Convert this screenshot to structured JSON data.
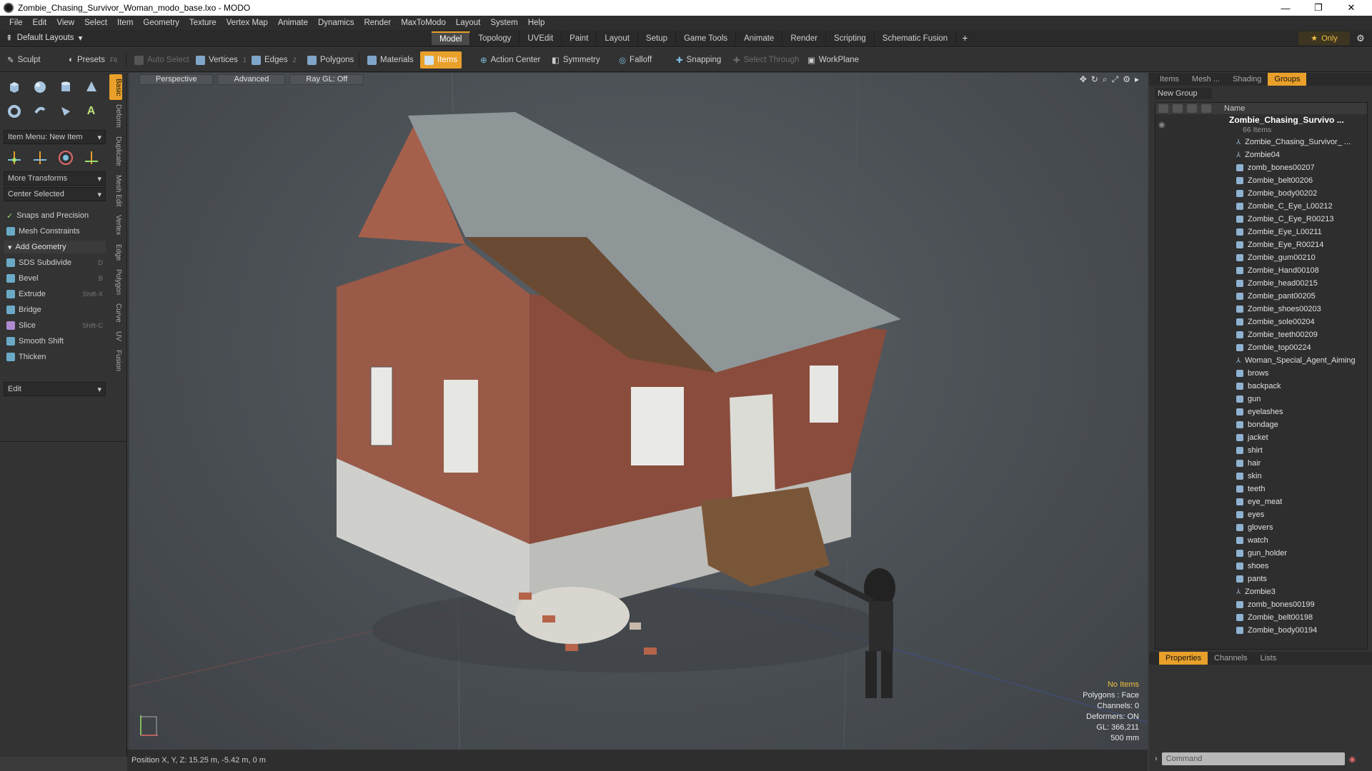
{
  "window": {
    "title": "Zombie_Chasing_Survivor_Woman_modo_base.lxo - MODO",
    "minimize": "—",
    "maximize": "❐",
    "close": "✕"
  },
  "menu": [
    "File",
    "Edit",
    "View",
    "Select",
    "Item",
    "Geometry",
    "Texture",
    "Vertex Map",
    "Animate",
    "Dynamics",
    "Render",
    "MaxToModo",
    "Layout",
    "System",
    "Help"
  ],
  "layout": {
    "default_layouts": "Default Layouts",
    "tabs": [
      "Model",
      "Topology",
      "UVEdit",
      "Paint",
      "Layout",
      "Setup",
      "Game Tools",
      "Animate",
      "Render",
      "Scripting",
      "Schematic Fusion"
    ],
    "active_tab": "Model",
    "plus": "+",
    "only_label": "Only"
  },
  "toolbar": {
    "sculpt": "Sculpt",
    "presets": "Presets",
    "presets_key": "F6",
    "auto_select": "Auto Select",
    "vertices": "Vertices",
    "vertices_key": "1",
    "edges": "Edges",
    "edges_key": "2",
    "polygons": "Polygons",
    "materials": "Materials",
    "items": "Items",
    "action_center": "Action Center",
    "symmetry": "Symmetry",
    "falloff": "Falloff",
    "snapping": "Snapping",
    "select_through": "Select Through",
    "workplane": "WorkPlane"
  },
  "left_panel": {
    "vertical_tabs": [
      "Basic",
      "Deform",
      "Duplicate",
      "Mesh Edit",
      "Vertex",
      "Edge",
      "Polygon",
      "Curve",
      "UV",
      "Fusion"
    ],
    "item_menu": "Item Menu: New Item",
    "more_transforms": "More Transforms",
    "center_selected": "Center Selected",
    "snaps_precision": "Snaps and Precision",
    "mesh_constraints": "Mesh Constraints",
    "add_geometry": "Add Geometry",
    "tools": [
      {
        "label": "SDS Subdivide",
        "shortcut": "D"
      },
      {
        "label": "Bevel",
        "shortcut": "B"
      },
      {
        "label": "Extrude",
        "shortcut": "Shift-X"
      },
      {
        "label": "Bridge",
        "shortcut": ""
      },
      {
        "label": "Slice",
        "shortcut": "Shift-C"
      },
      {
        "label": "Smooth Shift",
        "shortcut": ""
      },
      {
        "label": "Thicken",
        "shortcut": ""
      }
    ],
    "edit": "Edit"
  },
  "viewport": {
    "perspective": "Perspective",
    "advanced": "Advanced",
    "raygl": "Ray GL: Off",
    "stats": {
      "no_items": "No Items",
      "polygons": "Polygons : Face",
      "channels": "Channels: 0",
      "deformers": "Deformers: ON",
      "gl": "GL: 366,211",
      "scale": "500 mm"
    }
  },
  "status": {
    "position": "Position X, Y, Z:   15.25 m, -5.42 m, 0 m"
  },
  "right_panel": {
    "tabs": [
      "Items",
      "Mesh ...",
      "Shading",
      "Groups"
    ],
    "active_tab": "Groups",
    "new_group": "New Group",
    "name_header": "Name",
    "root": "Zombie_Chasing_Survivo ...",
    "root_sub": "66 Items",
    "items": [
      {
        "name": "Zombie_Chasing_Survivor_ ...",
        "type": "locator"
      },
      {
        "name": "Zombie04",
        "type": "locator"
      },
      {
        "name": "zomb_bones00207",
        "type": "mesh"
      },
      {
        "name": "Zombie_belt00206",
        "type": "mesh"
      },
      {
        "name": "Zombie_body00202",
        "type": "mesh"
      },
      {
        "name": "Zombie_C_Eye_L00212",
        "type": "mesh"
      },
      {
        "name": "Zombie_C_Eye_R00213",
        "type": "mesh"
      },
      {
        "name": "Zombie_Eye_L00211",
        "type": "mesh"
      },
      {
        "name": "Zombie_Eye_R00214",
        "type": "mesh"
      },
      {
        "name": "Zombie_gum00210",
        "type": "mesh"
      },
      {
        "name": "Zombie_Hand00108",
        "type": "mesh"
      },
      {
        "name": "Zombie_head00215",
        "type": "mesh"
      },
      {
        "name": "Zombie_pant00205",
        "type": "mesh"
      },
      {
        "name": "Zombie_shoes00203",
        "type": "mesh"
      },
      {
        "name": "Zombie_sole00204",
        "type": "mesh"
      },
      {
        "name": "Zombie_teeth00209",
        "type": "mesh"
      },
      {
        "name": "Zombie_top00224",
        "type": "mesh"
      },
      {
        "name": "Woman_Special_Agent_Aiming",
        "type": "locator"
      },
      {
        "name": "brows",
        "type": "mesh"
      },
      {
        "name": "backpack",
        "type": "mesh"
      },
      {
        "name": "gun",
        "type": "mesh"
      },
      {
        "name": "eyelashes",
        "type": "mesh"
      },
      {
        "name": "bondage",
        "type": "mesh"
      },
      {
        "name": "jacket",
        "type": "mesh"
      },
      {
        "name": "shirt",
        "type": "mesh"
      },
      {
        "name": "hair",
        "type": "mesh"
      },
      {
        "name": "skin",
        "type": "mesh"
      },
      {
        "name": "teeth",
        "type": "mesh"
      },
      {
        "name": "eye_meat",
        "type": "mesh"
      },
      {
        "name": "eyes",
        "type": "mesh"
      },
      {
        "name": "glovers",
        "type": "mesh"
      },
      {
        "name": "watch",
        "type": "mesh"
      },
      {
        "name": "gun_holder",
        "type": "mesh"
      },
      {
        "name": "shoes",
        "type": "mesh"
      },
      {
        "name": "pants",
        "type": "mesh"
      },
      {
        "name": "Zombie3",
        "type": "locator"
      },
      {
        "name": "zomb_bones00199",
        "type": "mesh"
      },
      {
        "name": "Zombie_belt00198",
        "type": "mesh"
      },
      {
        "name": "Zombie_body00194",
        "type": "mesh"
      }
    ],
    "props_tabs": [
      "Properties",
      "Channels",
      "Lists"
    ],
    "props_active": "Properties",
    "command_placeholder": "Command"
  },
  "colors": {
    "accent": "#e9a02a",
    "gold_text": "#f0c040"
  }
}
